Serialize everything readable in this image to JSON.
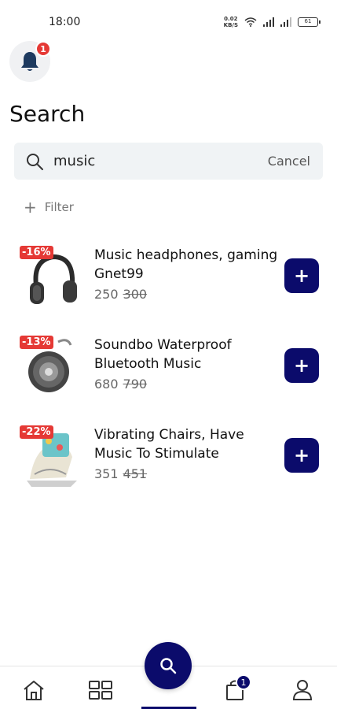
{
  "status_bar": {
    "time": "18:00",
    "speed_top": "0.02",
    "speed_bottom": "KB/S",
    "battery": "61"
  },
  "notifications": {
    "badge": "1",
    "icon": "bell-icon"
  },
  "page": {
    "title": "Search"
  },
  "search": {
    "value": "music",
    "cancel_label": "Cancel"
  },
  "filter": {
    "label": "Filter"
  },
  "products": [
    {
      "discount": "-16%",
      "name": "Music headphones, gaming Gnet99",
      "price": "250",
      "old_price": "300",
      "add_label": "+"
    },
    {
      "discount": "-13%",
      "name": "Soundbo Waterproof Bluetooth Music",
      "price": "680",
      "old_price": "790",
      "add_label": "+"
    },
    {
      "discount": "-22%",
      "name": "Vibrating Chairs, Have Music To Stimulate",
      "price": "351",
      "old_price": "451",
      "add_label": "+"
    }
  ],
  "bottom_nav": {
    "cart_badge": "1",
    "items": [
      "home-icon",
      "grid-icon",
      "search-icon",
      "cart-icon",
      "profile-icon"
    ]
  },
  "colors": {
    "accent": "#0b0b6b",
    "discount": "#e53935",
    "search_bg": "#f0f3f5"
  }
}
